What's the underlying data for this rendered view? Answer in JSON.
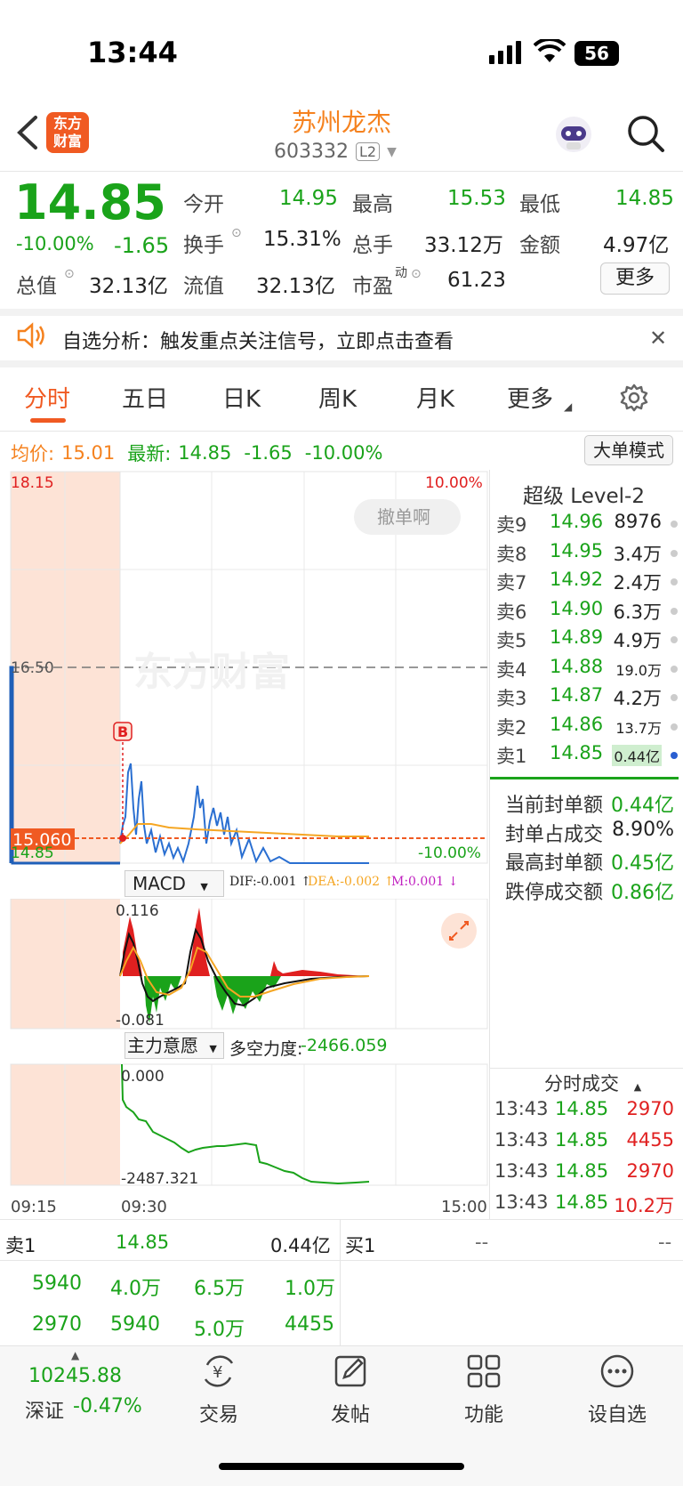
{
  "status_bar": {
    "time": "13:44",
    "battery": "56"
  },
  "header": {
    "app_logo_text": "东方财富",
    "title": "苏州龙杰",
    "code": "603332",
    "level_badge": "L2"
  },
  "quote": {
    "price": "14.85",
    "change_pct": "-10.00%",
    "change": "-1.65",
    "open_label": "今开",
    "open": "14.95",
    "high_label": "最高",
    "high": "15.53",
    "low_label": "最低",
    "low": "14.85",
    "turnover_label": "换手",
    "turnover": "15.31%",
    "volume_label": "总手",
    "volume": "33.12万",
    "amount_label": "金额",
    "amount": "4.97亿",
    "mktcap_label": "总值",
    "mktcap": "32.13亿",
    "float_label": "流值",
    "float": "32.13亿",
    "pe_label": "市盈",
    "pe_sup": "动",
    "pe": "61.23",
    "more_button": "更多"
  },
  "notice": {
    "text": "自选分析：触发重点关注信号，立即点击查看"
  },
  "tabs": [
    "分时",
    "五日",
    "日K",
    "周K",
    "月K",
    "更多"
  ],
  "chart_info": {
    "avg_label": "均价:",
    "avg": "15.01",
    "latest_label": "最新:",
    "latest": "14.85",
    "latest_change": "-1.65",
    "latest_pct": "-10.00%",
    "mode_button": "大单模式"
  },
  "chart_labels": {
    "top_price": "18.15",
    "mid_price": "16.50",
    "cur_price": "15.060",
    "low_price": "14.85",
    "top_pct": "10.00%",
    "low_pct": "-10.00%",
    "cancel_bubble": "撤单啊",
    "b_marker": "B",
    "watermark": "东方财富"
  },
  "macd": {
    "selector": "MACD",
    "dif": "DIF:-0.001 ↑",
    "dea": "DEA:-0.002 ↑",
    "m": "M:0.001 ↓",
    "top": "0.116",
    "bottom": "-0.081"
  },
  "main_force": {
    "selector": "主力意愿",
    "label": "多空力度:",
    "value": "-2466.059",
    "top": "0.000",
    "bottom": "-2487.321"
  },
  "time_axis": {
    "start": "09:15",
    "open": "09:30",
    "end": "15:00"
  },
  "orderbook": {
    "title": "超级 Level-2",
    "asks": [
      {
        "label": "卖9",
        "price": "14.96",
        "vol": "8976"
      },
      {
        "label": "卖8",
        "price": "14.95",
        "vol": "3.4万"
      },
      {
        "label": "卖7",
        "price": "14.92",
        "vol": "2.4万"
      },
      {
        "label": "卖6",
        "price": "14.90",
        "vol": "6.3万"
      },
      {
        "label": "卖5",
        "price": "14.89",
        "vol": "4.9万"
      },
      {
        "label": "卖4",
        "price": "14.88",
        "vol": "19.0万"
      },
      {
        "label": "卖3",
        "price": "14.87",
        "vol": "4.2万"
      },
      {
        "label": "卖2",
        "price": "14.86",
        "vol": "13.7万"
      },
      {
        "label": "卖1",
        "price": "14.85",
        "vol": "0.44亿"
      }
    ],
    "stats": [
      {
        "label": "当前封单额",
        "value": "0.44亿"
      },
      {
        "label": "封单占成交",
        "value": "8.90%"
      },
      {
        "label": "最高封单额",
        "value": "0.45亿"
      },
      {
        "label": "跌停成交额",
        "value": "0.86亿"
      }
    ]
  },
  "ticks": {
    "title": "分时成交",
    "rows": [
      {
        "time": "13:43",
        "price": "14.85",
        "vol": "2970"
      },
      {
        "time": "13:43",
        "price": "14.85",
        "vol": "4455"
      },
      {
        "time": "13:43",
        "price": "14.85",
        "vol": "2970"
      },
      {
        "time": "13:43",
        "price": "14.85",
        "vol": "10.2万"
      }
    ]
  },
  "bottom_book": {
    "sell_label": "卖1",
    "sell_price": "14.85",
    "sell_amount": "0.44亿",
    "buy_label": "买1",
    "buy_price": "--",
    "buy_amount": "--",
    "queue_row1": [
      "5940",
      "4.0万",
      "6.5万",
      "1.0万"
    ],
    "queue_row2": [
      "2970",
      "5940",
      "5.0万",
      "4455"
    ]
  },
  "bottom_nav": {
    "index_value": "10245.88",
    "index_name": "深证",
    "index_pct": "-0.47%",
    "items": [
      "交易",
      "发帖",
      "功能",
      "设自选"
    ]
  }
}
